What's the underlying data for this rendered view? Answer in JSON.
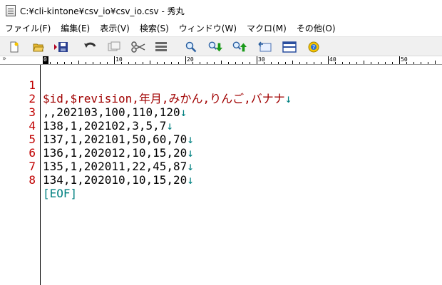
{
  "window": {
    "title": "C:¥cli-kintone¥csv_io¥csv_io.csv - 秀丸"
  },
  "menu": [
    "ファイル(F)",
    "編集(E)",
    "表示(V)",
    "検索(S)",
    "ウィンドウ(W)",
    "マクロ(M)",
    "その他(O)"
  ],
  "toolbar_icons": [
    "new-file-icon",
    "open-folder-icon",
    "save-icon",
    "undo-icon",
    "copy-icon",
    "cut-icon",
    "paste-icon",
    "search-icon",
    "find-next-icon",
    "find-prev-icon",
    "replace-icon",
    "window-split-icon",
    "help-icon"
  ],
  "ruler": {
    "labels": [
      "0",
      "10",
      "20",
      "30",
      "40",
      "50"
    ],
    "chevron": "»"
  },
  "editor": {
    "newline_mark": "↓",
    "lines": [
      {
        "num": "1",
        "text": "$id,$revision,年月,みかん,りんご,バナナ"
      },
      {
        "num": "2",
        "text": ",,202103,100,110,120"
      },
      {
        "num": "3",
        "text": "138,1,202102,3,5,7"
      },
      {
        "num": "4",
        "text": "137,1,202101,50,60,70"
      },
      {
        "num": "5",
        "text": "136,1,202012,10,15,20"
      },
      {
        "num": "6",
        "text": "135,1,202011,22,45,87"
      },
      {
        "num": "7",
        "text": "134,1,202010,10,15,20"
      },
      {
        "num": "8",
        "text": "[EOF]"
      }
    ]
  },
  "colors": {
    "line_number": "#c00000",
    "header_text": "#a00000",
    "eof": "#008080",
    "toolbar_bg": "#f0f0f0"
  }
}
